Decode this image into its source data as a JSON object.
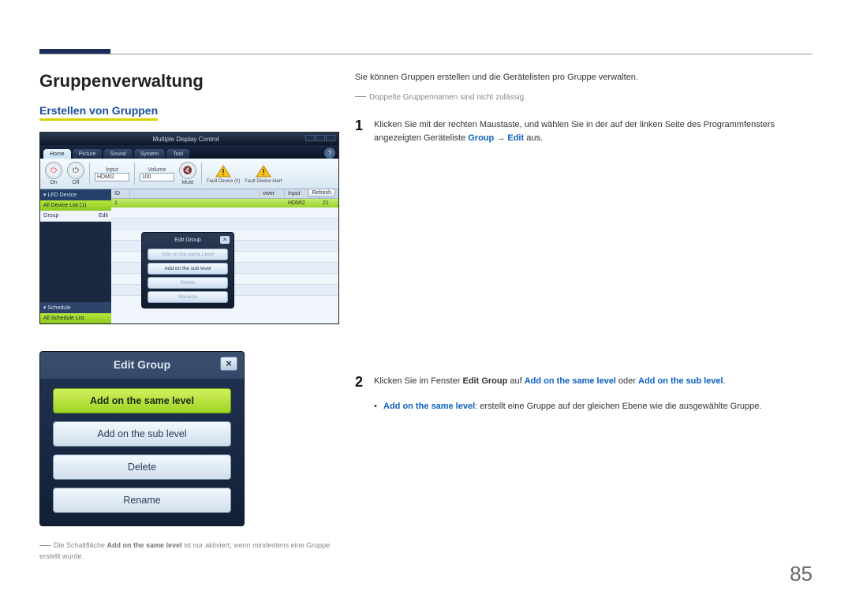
{
  "page": {
    "heading": "Gruppenverwaltung",
    "subheading": "Erstellen von Gruppen",
    "page_number": "85"
  },
  "mdc": {
    "title": "Multiple Display Control",
    "tabs": [
      "Home",
      "Picture",
      "Sound",
      "System",
      "Tool"
    ],
    "help": "?",
    "toolbar": {
      "on": "On",
      "off": "Off",
      "input_label": "Input",
      "input_value": "HDMI2",
      "volume_label": "Volume",
      "volume_value": "100",
      "mute": "Mute",
      "fault_device": "Fault Device (0)",
      "fault_alert": "Fault Device Alert"
    },
    "side": {
      "head": "▾ LFD Device",
      "all": "All Device List (1)",
      "group_label": "Group",
      "group_action": "Edit",
      "schedule": "▾ Schedule",
      "schedule_row": "All Schedule List"
    },
    "main": {
      "refresh": "Refresh",
      "col_id": "ID",
      "col_power": "ower",
      "col_input": "Input",
      "row_id": "1",
      "row_input": "HDMI2",
      "row_vol": "21"
    },
    "dialog": {
      "title": "Edit Group",
      "close": "×",
      "b1": "Add on the same Level",
      "b2": "Add on the sub level",
      "b3": "Delete",
      "b4": "Rename"
    }
  },
  "eg": {
    "title": "Edit Group",
    "close": "×",
    "b1": "Add on the same level",
    "b2": "Add on the sub level",
    "b3": "Delete",
    "b4": "Rename"
  },
  "left_footnote": {
    "pre": "Die Schaltfläche ",
    "bold": "Add on the same level",
    "post": " ist nur aktiviert, wenn mindestens eine Gruppe erstellt wurde."
  },
  "right": {
    "intro": "Sie können Gruppen erstellen und die Gerätelisten pro Gruppe verwalten.",
    "note": "Doppelte Gruppennamen sind nicht zulässig.",
    "step1_num": "1",
    "step1_a": "Klicken Sie mit der rechten Maustaste, und wählen Sie in der auf der linken Seite des Programmfensters angezeigten Geräteliste ",
    "step1_group": "Group",
    "step1_arrow": " → ",
    "step1_edit": "Edit",
    "step1_end": " aus.",
    "step2_num": "2",
    "step2_a": "Klicken Sie im Fenster ",
    "step2_eg": "Edit Group",
    "step2_b": " auf ",
    "step2_same": "Add on the same level",
    "step2_c": " oder ",
    "step2_sub": "Add on the sub level",
    "step2_d": ".",
    "bullet_dot": "•",
    "bullet_same": "Add on the same level",
    "bullet_text": ": erstellt eine Gruppe auf der gleichen Ebene wie die ausgewählte Gruppe."
  }
}
